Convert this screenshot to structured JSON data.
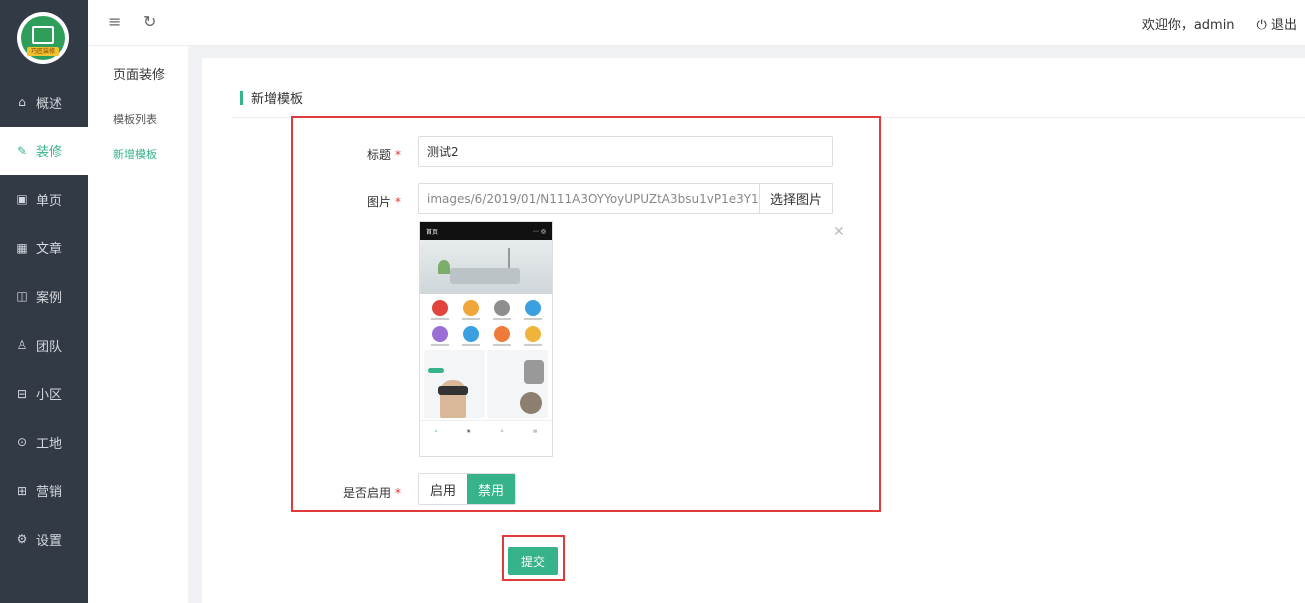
{
  "app": {
    "logo_text": "巧匠装修"
  },
  "sidebar": {
    "items": [
      {
        "icon": "home-icon",
        "glyph": "⌂",
        "label": "概述",
        "active": false
      },
      {
        "icon": "pen-icon",
        "glyph": "✎",
        "label": "装修",
        "active": true
      },
      {
        "icon": "page-icon",
        "glyph": "▣",
        "label": "单页",
        "active": false
      },
      {
        "icon": "grid-icon",
        "glyph": "▦",
        "label": "文章",
        "active": false
      },
      {
        "icon": "window-icon",
        "glyph": "◫",
        "label": "案例",
        "active": false
      },
      {
        "icon": "user-icon",
        "glyph": "♙",
        "label": "团队",
        "active": false
      },
      {
        "icon": "building-icon",
        "glyph": "⊟",
        "label": "小区",
        "active": false
      },
      {
        "icon": "location-icon",
        "glyph": "⊙",
        "label": "工地",
        "active": false
      },
      {
        "icon": "marketing-icon",
        "glyph": "⊞",
        "label": "营销",
        "active": false
      },
      {
        "icon": "gear-icon",
        "glyph": "⚙",
        "label": "设置",
        "active": false
      }
    ]
  },
  "topbar": {
    "menu_icon": "≡",
    "refresh_icon": "↻",
    "welcome": "欢迎你，admin",
    "logout": "退出",
    "logout_icon": "⏻"
  },
  "subnav": {
    "title": "页面装修",
    "items": [
      {
        "label": "模板列表",
        "active": false
      },
      {
        "label": "新增模板",
        "active": true
      }
    ]
  },
  "form": {
    "heading": "新增模板",
    "title_label": "标题",
    "title_value": "测试2",
    "image_label": "图片",
    "image_path": "images/6/2019/01/N111A3OYYoyUPUZtA3bsu1vP1e3Y1z.jpg",
    "pick_image_button": "选择图片",
    "remove_icon": "✕",
    "enable_label": "是否启用",
    "enable_option": "启用",
    "disable_option": "禁用",
    "enabled_selected": "禁用",
    "submit_button": "提交",
    "required_mark": "*"
  },
  "colors": {
    "accent": "#36b38a",
    "sidebar_bg": "#323a46",
    "highlight": "#e03a3a"
  },
  "preview": {
    "phone_title": "首页",
    "grid_colors": [
      "#e0443c",
      "#f0a63a",
      "#8e8e8e",
      "#3aa0e0",
      "#9b6ed6",
      "#3aa0e0",
      "#f07a3a",
      "#f0b43a"
    ]
  }
}
